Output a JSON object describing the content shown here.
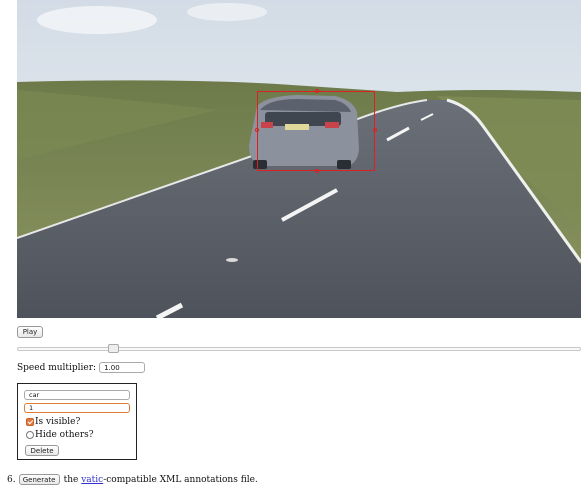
{
  "video": {
    "annotation": {
      "label": "car"
    }
  },
  "controls": {
    "play_label": "Play",
    "speed_label": "Speed multiplier:",
    "speed_value": "1.00"
  },
  "object_panel": {
    "label_value": "car",
    "id_value": "1",
    "visible_label": "Is visible?",
    "visible_checked": true,
    "hide_label": "Hide others?",
    "hide_checked": false,
    "delete_label": "Delete"
  },
  "footer": {
    "step_number": "6.",
    "generate_label": "Generate",
    "text_before_link": "the",
    "link_text": "vatic",
    "text_after_link": "-compatible XML annotations file."
  }
}
